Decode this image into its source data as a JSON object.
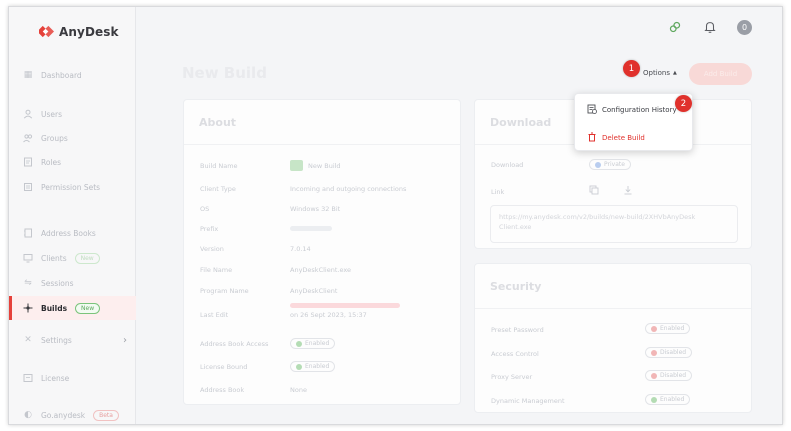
{
  "app": {
    "name": "AnyDesk"
  },
  "sidebar": {
    "items": [
      {
        "label": "Dashboard",
        "icon": "dashboard-icon"
      },
      {
        "label": "Users",
        "icon": "user-icon"
      },
      {
        "label": "Groups",
        "icon": "groups-icon"
      },
      {
        "label": "Roles",
        "icon": "roles-icon"
      },
      {
        "label": "Permission Sets",
        "icon": "permission-icon"
      },
      {
        "label": "Address Books",
        "icon": "address-book-icon"
      },
      {
        "label": "Clients",
        "icon": "monitor-icon",
        "badge": "New"
      },
      {
        "label": "Sessions",
        "icon": "sessions-icon"
      },
      {
        "label": "Builds",
        "icon": "builds-icon",
        "badge": "New",
        "active": true
      },
      {
        "label": "Settings",
        "icon": "settings-icon"
      },
      {
        "label": "License",
        "icon": "license-icon"
      },
      {
        "label": "Go.anydesk",
        "icon": "go-icon",
        "badge": "Beta"
      }
    ]
  },
  "header": {
    "avatar_initial": "0"
  },
  "page": {
    "title": "New Build"
  },
  "actions": {
    "options_label": "Options",
    "add_label": "Add Build"
  },
  "callouts": {
    "one": "1",
    "two": "2"
  },
  "menu": {
    "config_history": "Configuration History",
    "delete_build": "Delete Build"
  },
  "about": {
    "title": "About",
    "rows": [
      {
        "label": "Build Name",
        "value": "New Build"
      },
      {
        "label": "Client Type",
        "value": "Incoming and outgoing connections"
      },
      {
        "label": "OS",
        "value": "Windows 32 Bit"
      },
      {
        "label": "Prefix",
        "value": ""
      },
      {
        "label": "Version",
        "value": "7.0.14"
      },
      {
        "label": "File Name",
        "value": "AnyDeskClient.exe"
      },
      {
        "label": "Program Name",
        "value": "AnyDeskClient"
      },
      {
        "label": "Last Edit",
        "value": "on 26 Sept 2023, 15:37"
      },
      {
        "label": "Address Book Access",
        "value": "Enabled"
      },
      {
        "label": "License Bound",
        "value": "Enabled"
      },
      {
        "label": "Address Book",
        "value": "None"
      }
    ]
  },
  "download": {
    "title": "Download",
    "download_label": "Download",
    "download_status": "Private",
    "link_label": "Link",
    "link_text": "https://my.anydesk.com/v2/builds/new-build/2XHVbAnyDesk Client.exe"
  },
  "security": {
    "title": "Security",
    "rows": [
      {
        "label": "Preset Password",
        "value": "Enabled",
        "status": "red"
      },
      {
        "label": "Access Control",
        "value": "Disabled",
        "status": "red"
      },
      {
        "label": "Proxy Server",
        "value": "Disabled",
        "status": "red"
      },
      {
        "label": "Dynamic Management",
        "value": "Enabled",
        "status": "green"
      }
    ]
  },
  "colors": {
    "accent": "#e0312c",
    "sidebar_active_bg": "#fdeeee",
    "enabled_green": "#5fa85f"
  }
}
